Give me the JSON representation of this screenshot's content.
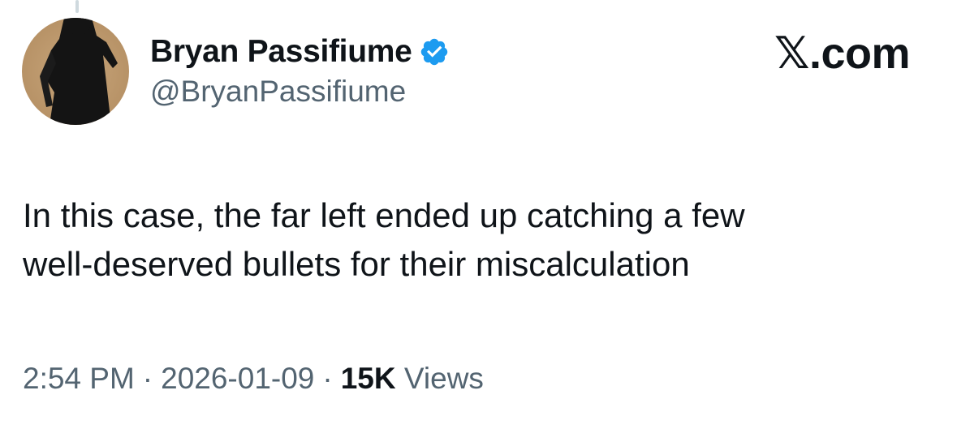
{
  "author": {
    "display_name": "Bryan Passifiume",
    "handle": "@BryanPassifiume",
    "verified_icon": "verified-badge-icon",
    "avatar": "silhouette-shadow-avatar"
  },
  "site": {
    "mark": "𝕏.com"
  },
  "tweet": {
    "lines": [
      "In this case, the far left ended up catching a few",
      "well-deserved bullets for their miscalculation"
    ]
  },
  "meta": {
    "time": "2:54 PM",
    "separator": "·",
    "date": "2026-01-09",
    "views_count": "15K",
    "views_label": "Views"
  },
  "colors": {
    "text_primary": "#0f1419",
    "text_secondary": "#536471",
    "verified_blue": "#1d9bf0",
    "thread_line": "#cfd9de"
  }
}
